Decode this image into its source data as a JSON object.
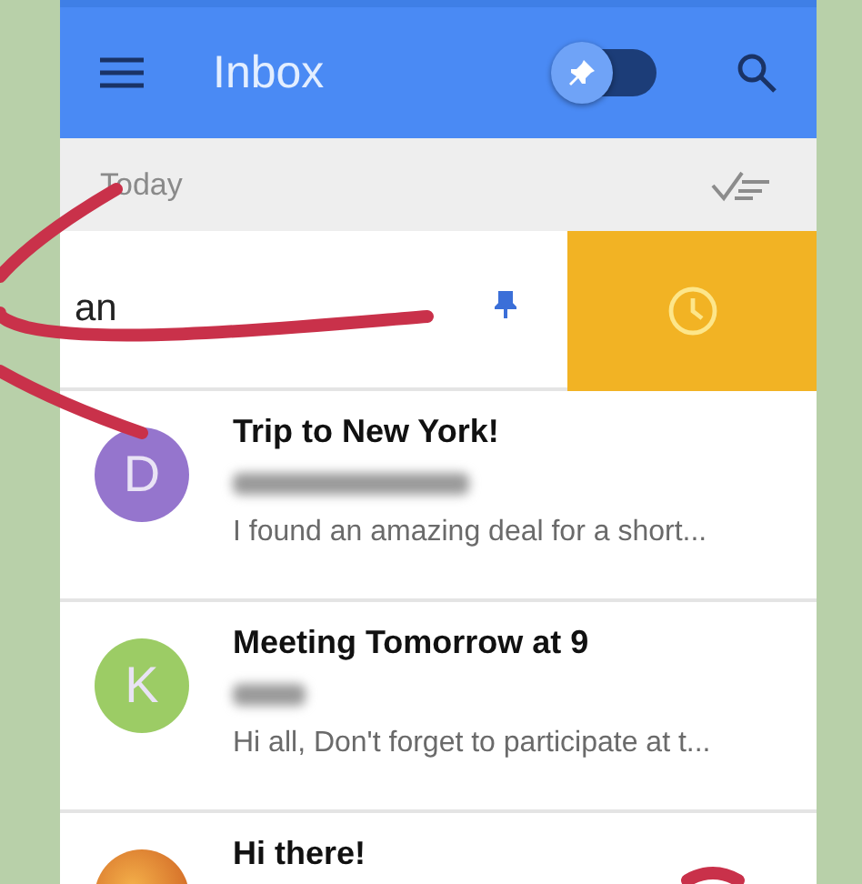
{
  "header": {
    "title": "Inbox",
    "pin_toggle": {
      "on": true
    }
  },
  "section": {
    "label": "Today"
  },
  "swiped_item": {
    "text": "an",
    "pinned": true
  },
  "emails": [
    {
      "avatar": {
        "kind": "letter",
        "letter": "D",
        "color": "#9575cd"
      },
      "subject": "Trip to New York!",
      "preview": "I found an amazing deal for a short..."
    },
    {
      "avatar": {
        "kind": "letter",
        "letter": "K",
        "color": "#9ccc65"
      },
      "subject": "Meeting Tomorrow at 9",
      "preview": "Hi all, Don't forget to participate at t..."
    },
    {
      "avatar": {
        "kind": "photo"
      },
      "subject": "Hi there!"
    }
  ]
}
